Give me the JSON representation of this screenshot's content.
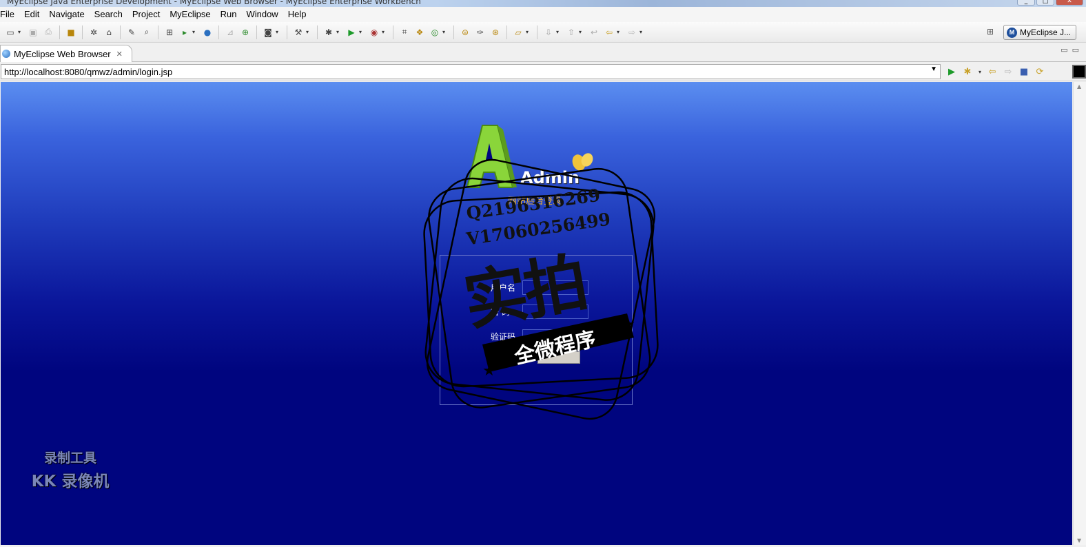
{
  "window": {
    "title": "MyEclipse Java Enterprise Development - MyEclipse Web Browser - MyEclipse Enterprise Workbench"
  },
  "menu": [
    "File",
    "Edit",
    "Navigate",
    "Search",
    "Project",
    "MyEclipse",
    "Run",
    "Window",
    "Help"
  ],
  "perspective": {
    "label": "MyEclipse J..."
  },
  "editor_tab": {
    "label": "MyEclipse Web Browser"
  },
  "browser": {
    "url": "http://localhost:8080/qmwz/admin/login.jsp"
  },
  "page": {
    "logo_text": "Admin",
    "subtitle": "网站后台登录",
    "fields": [
      {
        "label": "用户名",
        "value": ""
      },
      {
        "label": "密  码",
        "value": ""
      },
      {
        "label": "验证码",
        "value": ""
      }
    ]
  },
  "watermark": {
    "qq": "Q2196316269",
    "vx": "V17060256499",
    "big": "实拍",
    "banner": "全微程序"
  },
  "recorder": {
    "line1": "录制工具",
    "line2": "KK 录像机"
  },
  "colors": {
    "page_top": "#5b8ef0",
    "page_bottom": "#00057f",
    "subtitle": "#f1b52a",
    "logo_green": "#8ad53a"
  }
}
